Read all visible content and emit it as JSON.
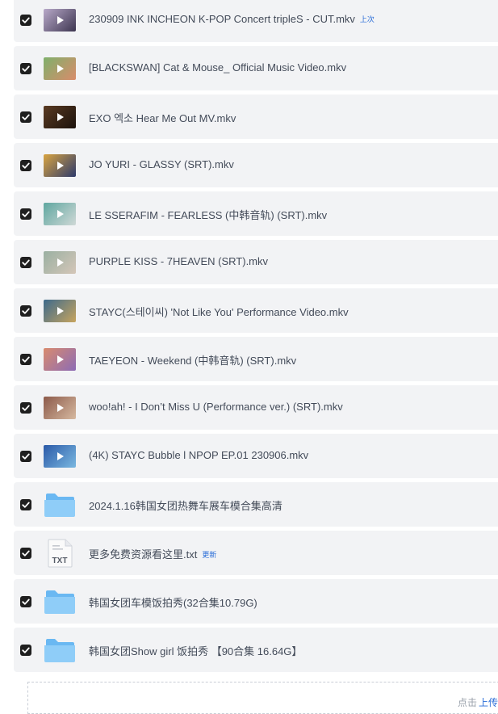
{
  "files": [
    {
      "name": "230909 INK INCHEON K-POP Concert tripleS - CUT.mkv",
      "tag": "上次",
      "type": "video",
      "thumb": [
        "#b8a9c9",
        "#3d3550"
      ]
    },
    {
      "name": "[BLACKSWAN] Cat & Mouse_ Official Music Video.mkv",
      "tag": "",
      "type": "video",
      "thumb": [
        "#7fb06b",
        "#d98c6b"
      ]
    },
    {
      "name": "EXO 엑소 Hear Me Out MV.mkv",
      "tag": "",
      "type": "video",
      "thumb": [
        "#5a3a22",
        "#1b120c"
      ]
    },
    {
      "name": "JO YURI - GLASSY (SRT).mkv",
      "tag": "",
      "type": "video",
      "thumb": [
        "#d9a441",
        "#2d3a6b"
      ]
    },
    {
      "name": "LE SSERAFIM - FEARLESS (中韩音轨) (SRT).mkv",
      "tag": "",
      "type": "video",
      "thumb": [
        "#5fa7a0",
        "#cfd8d6"
      ]
    },
    {
      "name": "PURPLE KISS - 7HEAVEN (SRT).mkv",
      "tag": "",
      "type": "video",
      "thumb": [
        "#9ab0a2",
        "#d4c6b8"
      ]
    },
    {
      "name": "STAYC(스테이씨) 'Not Like You' Performance Video.mkv",
      "tag": "",
      "type": "video",
      "thumb": [
        "#3d6a8c",
        "#c7a45e"
      ]
    },
    {
      "name": "TAEYEON - Weekend (中韩音轨) (SRT).mkv",
      "tag": "",
      "type": "video",
      "thumb": [
        "#d98b6e",
        "#8c6bb5"
      ]
    },
    {
      "name": "woo!ah! - I Don’t Miss U (Performance ver.) (SRT).mkv",
      "tag": "",
      "type": "video",
      "thumb": [
        "#8c5a4a",
        "#d6b9a0"
      ]
    },
    {
      "name": "(4K) STAYC Bubble l NPOP EP.01 230906.mkv",
      "tag": "",
      "type": "video",
      "thumb": [
        "#2b5aa8",
        "#7ab8e0"
      ]
    },
    {
      "name": "2024.1.16韩国女团热舞车展车模合集高清",
      "tag": "",
      "type": "folder"
    },
    {
      "name": "更多免费资源看这里.txt",
      "tag": "更新",
      "type": "txt",
      "icon_label": "TXT"
    },
    {
      "name": "韩国女团车模饭拍秀(32合集10.79G)",
      "tag": "",
      "type": "folder"
    },
    {
      "name": "韩国女团Show girl 饭拍秀 【90合集 16.64G】",
      "tag": "",
      "type": "folder"
    }
  ],
  "dropzone": {
    "hint": "点击",
    "link": "上传"
  },
  "colors": {
    "accent": "#2a6dd8",
    "row_bg": "#f2f3f5",
    "checkbox": "#1f1f1f",
    "folder": "#7cc3f5"
  }
}
